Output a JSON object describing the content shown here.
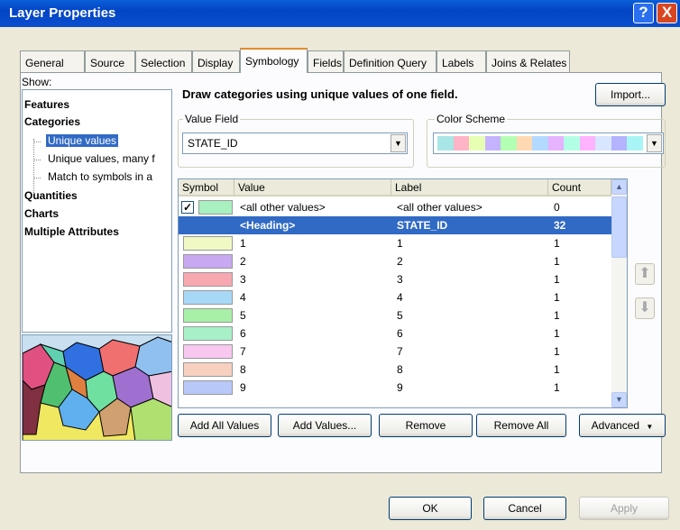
{
  "window": {
    "title": "Layer Properties",
    "help_glyph": "?",
    "close_glyph": "X"
  },
  "tabs": [
    "General",
    "Source",
    "Selection",
    "Display",
    "Symbology",
    "Fields",
    "Definition Query",
    "Labels",
    "Joins & Relates"
  ],
  "active_tab": "Symbology",
  "show": {
    "label": "Show:",
    "items": [
      "Features",
      "Categories",
      "Unique values",
      "Unique values, many f",
      "Match to symbols in a",
      "Quantities",
      "Charts",
      "Multiple Attributes"
    ]
  },
  "description": "Draw categories using unique values of one field.",
  "import_label": "Import...",
  "value_field": {
    "label": "Value Field",
    "value": "STATE_ID"
  },
  "color_scheme": {
    "label": "Color Scheme",
    "colors": [
      "#A9E6E6",
      "#FFB3C6",
      "#E6FFB3",
      "#C6B3FF",
      "#B3FFB3",
      "#FFD9B3",
      "#B3D9FF",
      "#E6B3FF",
      "#B3FFE6",
      "#FFB3FF",
      "#D9E6FF",
      "#B3B3FF",
      "#A9F5F5"
    ]
  },
  "grid": {
    "headers": [
      "Symbol",
      "Value",
      "Label",
      "Count"
    ],
    "rows": [
      {
        "checked": true,
        "color": "#A8F0C0",
        "value": "<all other values>",
        "label": "<all other values>",
        "count": "0"
      },
      {
        "heading": true,
        "value": "<Heading>",
        "label": "STATE_ID",
        "count": "32"
      },
      {
        "color": "#F0F8C4",
        "value": "1",
        "label": "1",
        "count": "1"
      },
      {
        "color": "#C8A8F0",
        "value": "2",
        "label": "2",
        "count": "1"
      },
      {
        "color": "#F8A8B0",
        "value": "3",
        "label": "3",
        "count": "1"
      },
      {
        "color": "#A8D8F8",
        "value": "4",
        "label": "4",
        "count": "1"
      },
      {
        "color": "#A8F0A8",
        "value": "5",
        "label": "5",
        "count": "1"
      },
      {
        "color": "#A8F0C8",
        "value": "6",
        "label": "6",
        "count": "1"
      },
      {
        "color": "#F8C8F0",
        "value": "7",
        "label": "7",
        "count": "1"
      },
      {
        "color": "#F8D0C0",
        "value": "8",
        "label": "8",
        "count": "1"
      },
      {
        "color": "#B8C8F8",
        "value": "9",
        "label": "9",
        "count": "1"
      }
    ]
  },
  "buttons": {
    "add_all": "Add All Values",
    "add_values": "Add Values...",
    "remove": "Remove",
    "remove_all": "Remove All",
    "advanced": "Advanced",
    "ok": "OK",
    "cancel": "Cancel",
    "apply": "Apply"
  }
}
